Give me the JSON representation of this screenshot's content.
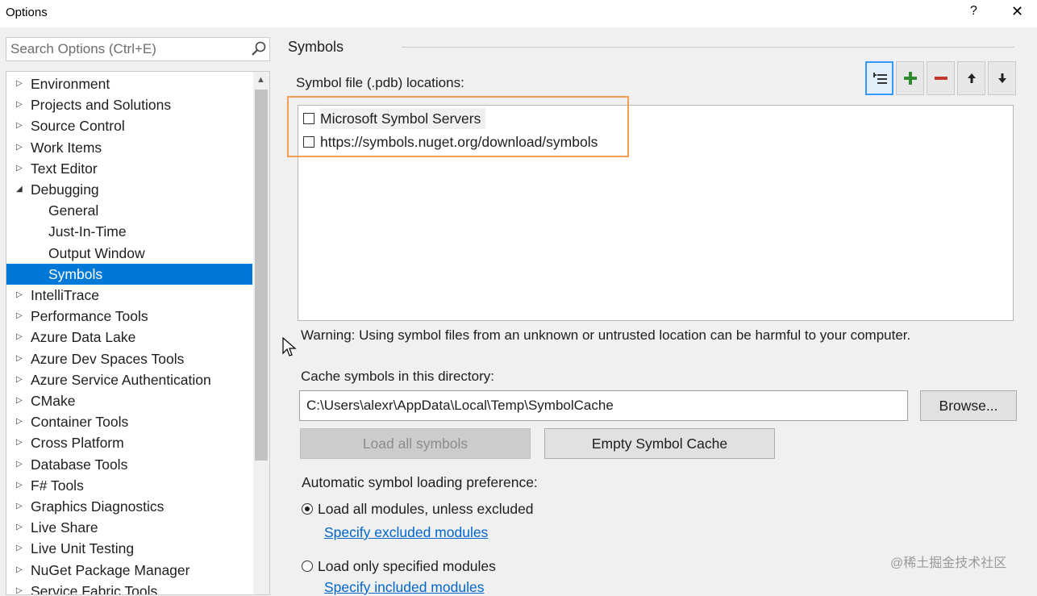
{
  "window": {
    "title": "Options",
    "help_glyph": "?",
    "close_glyph": "✕"
  },
  "search": {
    "placeholder": "Search Options (Ctrl+E)",
    "icon": "search-icon"
  },
  "tree": {
    "items": [
      {
        "label": "Environment",
        "expanded": false
      },
      {
        "label": "Projects and Solutions",
        "expanded": false
      },
      {
        "label": "Source Control",
        "expanded": false
      },
      {
        "label": "Work Items",
        "expanded": false
      },
      {
        "label": "Text Editor",
        "expanded": false
      },
      {
        "label": "Debugging",
        "expanded": true
      },
      {
        "label": "General",
        "child": true
      },
      {
        "label": "Just-In-Time",
        "child": true
      },
      {
        "label": "Output Window",
        "child": true
      },
      {
        "label": "Symbols",
        "child": true,
        "selected": true
      },
      {
        "label": "IntelliTrace",
        "expanded": false
      },
      {
        "label": "Performance Tools",
        "expanded": false
      },
      {
        "label": "Azure Data Lake",
        "expanded": false
      },
      {
        "label": "Azure Dev Spaces Tools",
        "expanded": false
      },
      {
        "label": "Azure Service Authentication",
        "expanded": false
      },
      {
        "label": "CMake",
        "expanded": false
      },
      {
        "label": "Container Tools",
        "expanded": false
      },
      {
        "label": "Cross Platform",
        "expanded": false
      },
      {
        "label": "Database Tools",
        "expanded": false
      },
      {
        "label": "F# Tools",
        "expanded": false
      },
      {
        "label": "Graphics Diagnostics",
        "expanded": false
      },
      {
        "label": "Live Share",
        "expanded": false
      },
      {
        "label": "Live Unit Testing",
        "expanded": false
      },
      {
        "label": "NuGet Package Manager",
        "expanded": false
      },
      {
        "label": "Service Fabric Tools",
        "expanded": false
      }
    ]
  },
  "symbols": {
    "section_title": "Symbols",
    "pdb_label": "Symbol file (.pdb) locations:",
    "toolbar": [
      "add-server-list-icon",
      "add-icon",
      "remove-icon",
      "move-up-icon",
      "move-down-icon"
    ],
    "locations": [
      {
        "label": "Microsoft Symbol Servers",
        "checked": false
      },
      {
        "label": "https://symbols.nuget.org/download/symbols",
        "checked": false
      }
    ],
    "warning": "Warning: Using symbol files from an unknown or untrusted location can be harmful to your computer.",
    "cache_label": "Cache symbols in this directory:",
    "cache_path": "C:\\Users\\alexr\\AppData\\Local\\Temp\\SymbolCache",
    "browse_label": "Browse...",
    "load_all_label": "Load all symbols",
    "empty_cache_label": "Empty Symbol Cache",
    "auto_label": "Automatic symbol loading preference:",
    "option_all": "Load all modules, unless excluded",
    "link_excluded": "Specify excluded modules",
    "option_specified": "Load only specified modules",
    "link_included": "Specify included modules"
  },
  "watermark": "@稀土掘金技术社区",
  "colors": {
    "selection": "#0078d7",
    "highlight_box": "#f0a050",
    "link": "#0066cc",
    "add_green": "#2e8b2e",
    "remove_red": "#c0392b"
  }
}
